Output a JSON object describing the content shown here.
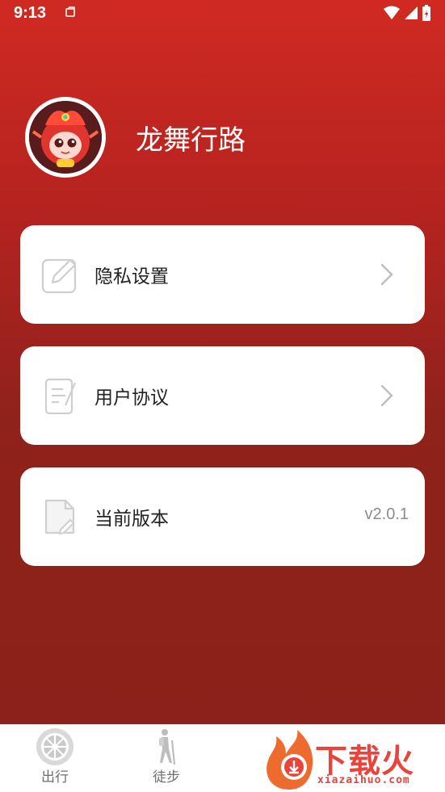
{
  "status_bar": {
    "time": "9:13"
  },
  "profile": {
    "app_name": "龙舞行路"
  },
  "menu": [
    {
      "label": "隐私设置",
      "icon": "edit-icon",
      "action": "chevron-right-icon"
    },
    {
      "label": "用户协议",
      "icon": "document-icon",
      "action": "chevron-right-icon"
    },
    {
      "label": "当前版本",
      "icon": "file-icon",
      "value": "v2.0.1"
    }
  ],
  "tabs": [
    {
      "label": "出行",
      "icon": "wheel-icon"
    },
    {
      "label": "徒步",
      "icon": "hiker-icon"
    }
  ],
  "watermark": {
    "text": "下载火",
    "url": "xiazaihuo.com"
  },
  "colors": {
    "primary": "#b52320",
    "background_dark": "#8a211a",
    "card": "#ffffff",
    "watermark": "#e8443c"
  }
}
